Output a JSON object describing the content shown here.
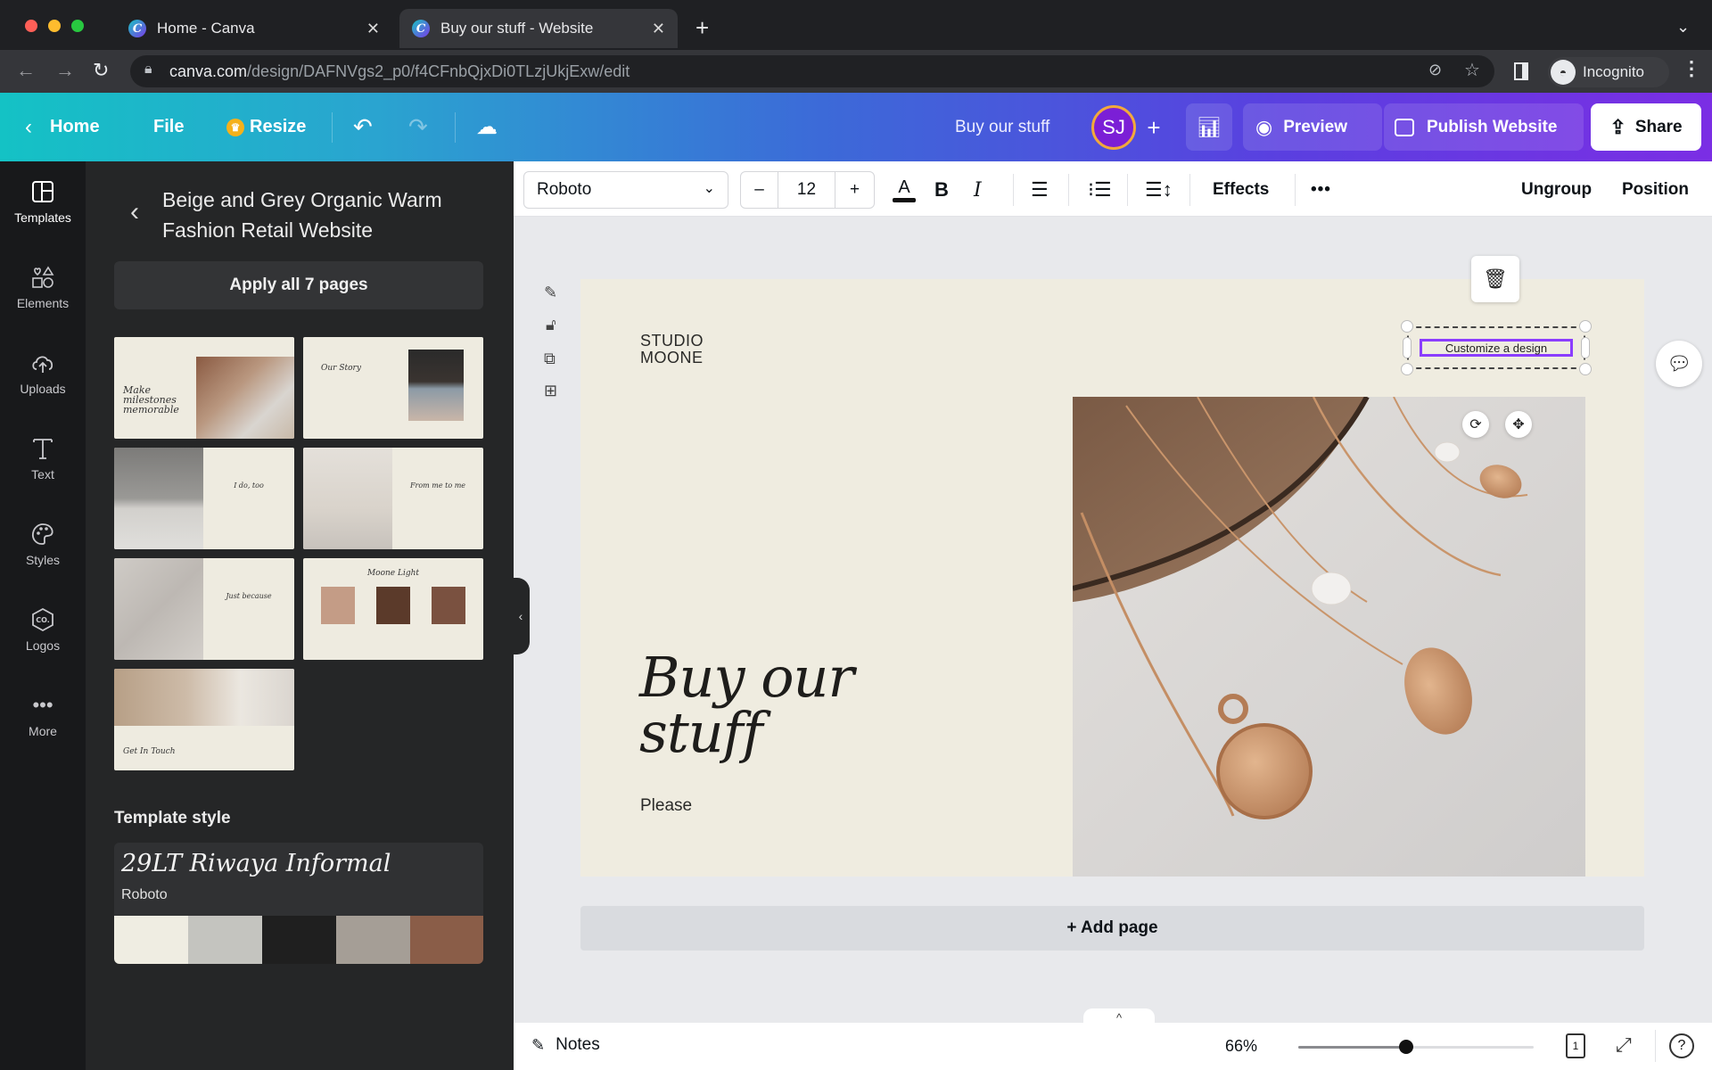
{
  "browser": {
    "tabs": [
      {
        "title": "Home - Canva",
        "active": false
      },
      {
        "title": "Buy our stuff - Website",
        "active": true
      }
    ],
    "new_tab_label": "+",
    "url_host": "canva.com",
    "url_path": "/design/DAFNVgs2_p0/f4CFnbQjxDi0TLzjUkjExw/edit",
    "profile_label": "Incognito"
  },
  "topbar": {
    "home_label": "Home",
    "file_label": "File",
    "resize_label": "Resize",
    "design_title": "Buy our stuff",
    "avatar_initials": "SJ",
    "add_collaborator": "+",
    "preview_label": "Preview",
    "publish_label": "Publish Website",
    "share_label": "Share"
  },
  "rail": {
    "items": [
      {
        "label": "Templates",
        "icon": "templates-icon"
      },
      {
        "label": "Elements",
        "icon": "elements-icon"
      },
      {
        "label": "Uploads",
        "icon": "uploads-icon"
      },
      {
        "label": "Text",
        "icon": "text-icon"
      },
      {
        "label": "Styles",
        "icon": "styles-icon"
      },
      {
        "label": "Logos",
        "icon": "logos-icon"
      },
      {
        "label": "More",
        "icon": "more-icon"
      }
    ]
  },
  "panel": {
    "template_title": "Beige and Grey Organic Warm Fashion Retail Website",
    "apply_label": "Apply all 7 pages",
    "thumbnails": [
      {
        "caption": "Make milestones memorable"
      },
      {
        "caption": "Our Story"
      },
      {
        "caption": "I do, too"
      },
      {
        "caption": "From me to me"
      },
      {
        "caption": "Just because"
      },
      {
        "caption": "Moone Light"
      },
      {
        "caption": "Get In Touch"
      }
    ],
    "style_heading": "Template style",
    "style_font_primary": "29LT Riwaya Informal",
    "style_font_secondary": "Roboto",
    "palette": [
      "#efede2",
      "#c4c4bf",
      "#1f1f1f",
      "#a59e96",
      "#8a5d48"
    ]
  },
  "toolbar": {
    "font_name": "Roboto",
    "font_size": "12",
    "decrease": "–",
    "increase": "+",
    "effects_label": "Effects",
    "more_label": "•••",
    "ungroup_label": "Ungroup",
    "position_label": "Position"
  },
  "canvas": {
    "logo_line1": "STUDIO",
    "logo_line2": "MOONE",
    "headline_line1": "Buy our",
    "headline_line2": "stuff",
    "subtext": "Please",
    "selected_button_text": "Customize a design",
    "add_page_label": "+ Add page"
  },
  "bottombar": {
    "notes_label": "Notes",
    "zoom_label": "66%",
    "zoom_fraction": 0.46,
    "page_count": "1"
  }
}
